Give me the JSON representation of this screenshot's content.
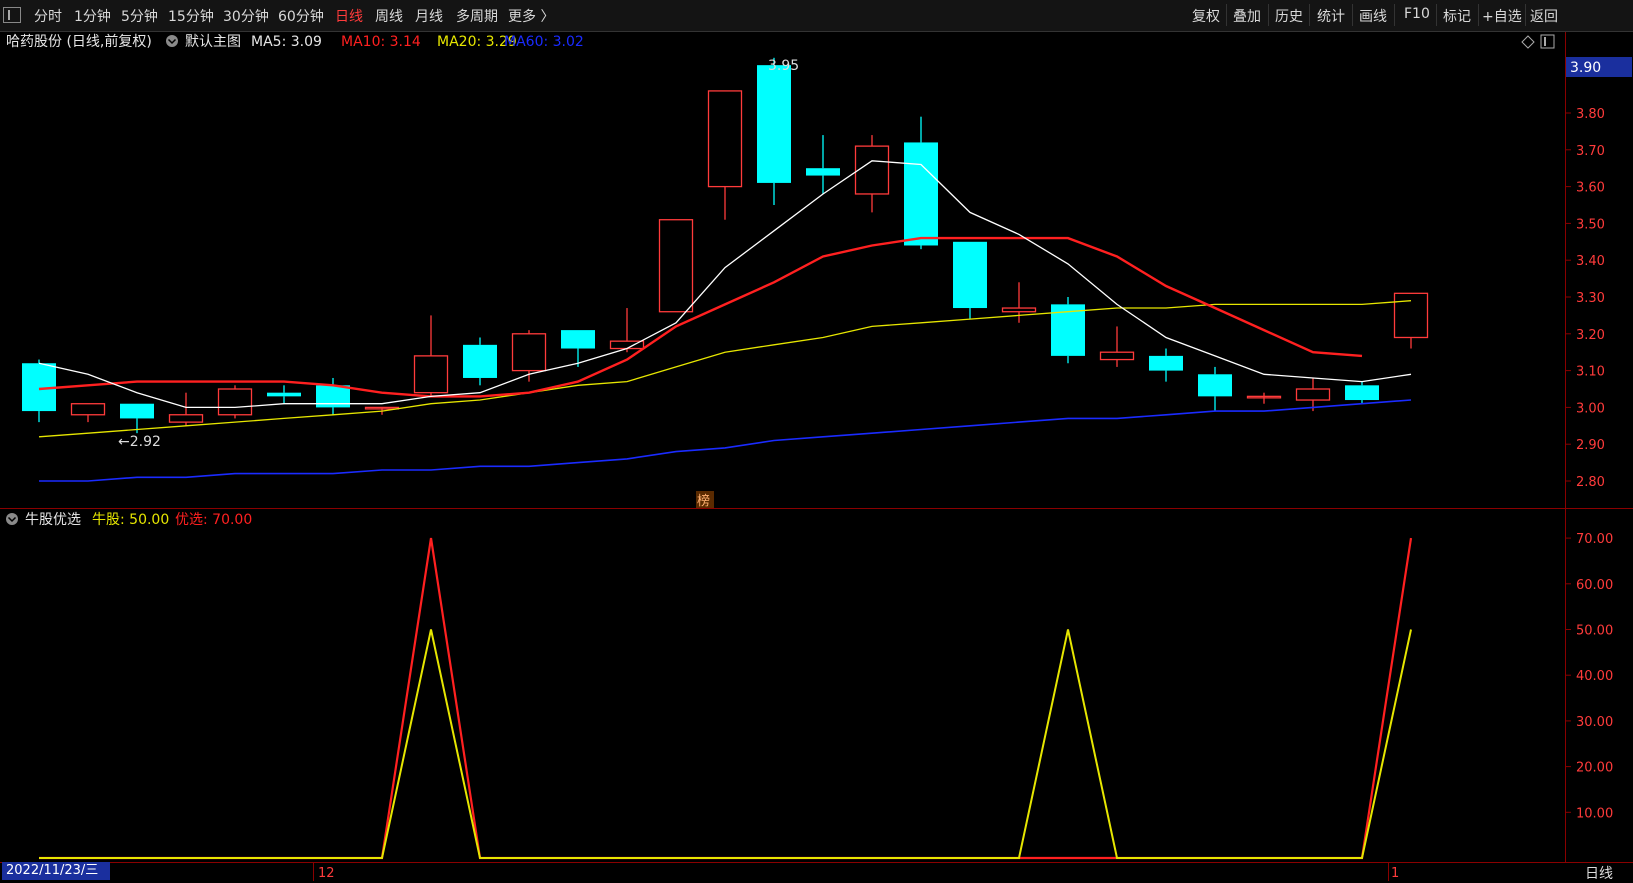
{
  "toolbar": {
    "left": [
      "分时",
      "1分钟",
      "5分钟",
      "15分钟",
      "30分钟",
      "60分钟",
      "日线",
      "周线",
      "月线",
      "多周期",
      "更多 〉"
    ],
    "active": "日线",
    "right": [
      "复权",
      "叠加",
      "历史",
      "统计",
      "画线",
      "F10",
      "标记",
      "+自选",
      "返回"
    ]
  },
  "main": {
    "stock_title": "哈药股份 (日线,前复权)",
    "template_label": "默认主图",
    "ma5_label": "MA5: 3.09",
    "ma10_label": "MA10: 3.14",
    "ma20_label": "MA20: 3.29",
    "ma60_label": "MA60: 3.02",
    "price_axis": [
      "3.80",
      "3.70",
      "3.60",
      "3.50",
      "3.40",
      "3.30",
      "3.20",
      "3.10",
      "3.00",
      "2.90",
      "2.80"
    ],
    "current_price_tag": "3.90",
    "high_marker": "3.95",
    "low_marker": "←2.92",
    "bang_badge": "榜",
    "colors": {
      "up": "#ff3b3b",
      "down": "#00ffff",
      "ma5": "#ffffff",
      "ma10": "#ff2020",
      "ma20": "#e6e600",
      "ma60": "#1a2bff"
    }
  },
  "indicator": {
    "name": "牛股优选",
    "niu_label": "牛股: 50.00",
    "you_label": "优选: 70.00",
    "axis": [
      "70.00",
      "60.00",
      "50.00",
      "40.00",
      "30.00",
      "20.00",
      "10.00"
    ]
  },
  "chart_data": {
    "type": "candlestick",
    "price_range": [
      2.78,
      3.98
    ],
    "candles": [
      {
        "o": 3.12,
        "h": 3.13,
        "l": 2.96,
        "c": 2.99
      },
      {
        "o": 2.98,
        "h": 3.01,
        "l": 2.96,
        "c": 3.01
      },
      {
        "o": 3.01,
        "h": 3.01,
        "l": 2.93,
        "c": 2.97
      },
      {
        "o": 2.96,
        "h": 3.04,
        "l": 2.95,
        "c": 2.98
      },
      {
        "o": 2.98,
        "h": 3.06,
        "l": 2.97,
        "c": 3.05
      },
      {
        "o": 3.04,
        "h": 3.06,
        "l": 3.01,
        "c": 3.03
      },
      {
        "o": 3.06,
        "h": 3.08,
        "l": 2.98,
        "c": 3.0
      },
      {
        "o": 3.0,
        "h": 3.0,
        "l": 2.98,
        "c": 3.0
      },
      {
        "o": 3.04,
        "h": 3.25,
        "l": 3.03,
        "c": 3.14
      },
      {
        "o": 3.17,
        "h": 3.19,
        "l": 3.06,
        "c": 3.08
      },
      {
        "o": 3.1,
        "h": 3.21,
        "l": 3.07,
        "c": 3.2
      },
      {
        "o": 3.21,
        "h": 3.21,
        "l": 3.11,
        "c": 3.16
      },
      {
        "o": 3.16,
        "h": 3.27,
        "l": 3.15,
        "c": 3.18
      },
      {
        "o": 3.26,
        "h": 3.51,
        "l": 3.26,
        "c": 3.51
      },
      {
        "o": 3.6,
        "h": 3.86,
        "l": 3.51,
        "c": 3.86
      },
      {
        "o": 3.93,
        "h": 3.95,
        "l": 3.55,
        "c": 3.61
      },
      {
        "o": 3.65,
        "h": 3.74,
        "l": 3.58,
        "c": 3.63
      },
      {
        "o": 3.58,
        "h": 3.74,
        "l": 3.53,
        "c": 3.71
      },
      {
        "o": 3.72,
        "h": 3.79,
        "l": 3.43,
        "c": 3.44
      },
      {
        "o": 3.45,
        "h": 3.45,
        "l": 3.24,
        "c": 3.27
      },
      {
        "o": 3.26,
        "h": 3.34,
        "l": 3.23,
        "c": 3.27
      },
      {
        "o": 3.28,
        "h": 3.3,
        "l": 3.12,
        "c": 3.14
      },
      {
        "o": 3.13,
        "h": 3.22,
        "l": 3.11,
        "c": 3.15
      },
      {
        "o": 3.14,
        "h": 3.16,
        "l": 3.07,
        "c": 3.1
      },
      {
        "o": 3.09,
        "h": 3.11,
        "l": 2.99,
        "c": 3.03
      },
      {
        "o": 3.03,
        "h": 3.04,
        "l": 3.01,
        "c": 3.03
      },
      {
        "o": 3.02,
        "h": 3.08,
        "l": 2.99,
        "c": 3.05
      },
      {
        "o": 3.06,
        "h": 3.07,
        "l": 3.01,
        "c": 3.02
      },
      {
        "o": 3.19,
        "h": 3.31,
        "l": 3.16,
        "c": 3.31
      }
    ],
    "ma5": [
      3.12,
      3.09,
      3.04,
      3.0,
      3.0,
      3.01,
      3.01,
      3.01,
      3.03,
      3.04,
      3.09,
      3.12,
      3.16,
      3.23,
      3.38,
      3.48,
      3.58,
      3.67,
      3.66,
      3.53,
      3.47,
      3.39,
      3.28,
      3.19,
      3.14,
      3.09,
      3.08,
      3.07,
      3.09
    ],
    "ma10": [
      3.05,
      3.06,
      3.07,
      3.07,
      3.07,
      3.07,
      3.06,
      3.04,
      3.03,
      3.03,
      3.04,
      3.07,
      3.13,
      3.22,
      3.28,
      3.34,
      3.41,
      3.44,
      3.46,
      3.46,
      3.46,
      3.46,
      3.41,
      3.33,
      3.27,
      3.21,
      3.15,
      3.14
    ],
    "ma20": [
      2.92,
      2.93,
      2.94,
      2.95,
      2.96,
      2.97,
      2.98,
      2.99,
      3.01,
      3.02,
      3.04,
      3.06,
      3.07,
      3.11,
      3.15,
      3.17,
      3.19,
      3.22,
      3.23,
      3.24,
      3.25,
      3.26,
      3.27,
      3.27,
      3.28,
      3.28,
      3.28,
      3.28,
      3.29
    ],
    "ma60": [
      2.8,
      2.8,
      2.81,
      2.81,
      2.82,
      2.82,
      2.82,
      2.83,
      2.83,
      2.84,
      2.84,
      2.85,
      2.86,
      2.88,
      2.89,
      2.91,
      2.92,
      2.93,
      2.94,
      2.95,
      2.96,
      2.97,
      2.97,
      2.98,
      2.99,
      2.99,
      3.0,
      3.01,
      3.02
    ],
    "indicator_range": [
      0,
      70
    ],
    "niu": [
      0,
      0,
      0,
      0,
      0,
      0,
      0,
      0,
      50,
      0,
      0,
      0,
      0,
      0,
      0,
      0,
      0,
      0,
      0,
      0,
      0,
      50,
      0,
      0,
      0,
      0,
      0,
      0,
      50
    ],
    "you": [
      0,
      0,
      0,
      0,
      0,
      0,
      0,
      0,
      70,
      0,
      0,
      0,
      0,
      0,
      0,
      0,
      0,
      0,
      0,
      0,
      0,
      0,
      0,
      0,
      0,
      0,
      0,
      0,
      70
    ],
    "x_labels": {
      "date": "2022/11/23/三",
      "month_12": "12",
      "month_1": "1"
    }
  },
  "status": {
    "period_label": "日线"
  }
}
